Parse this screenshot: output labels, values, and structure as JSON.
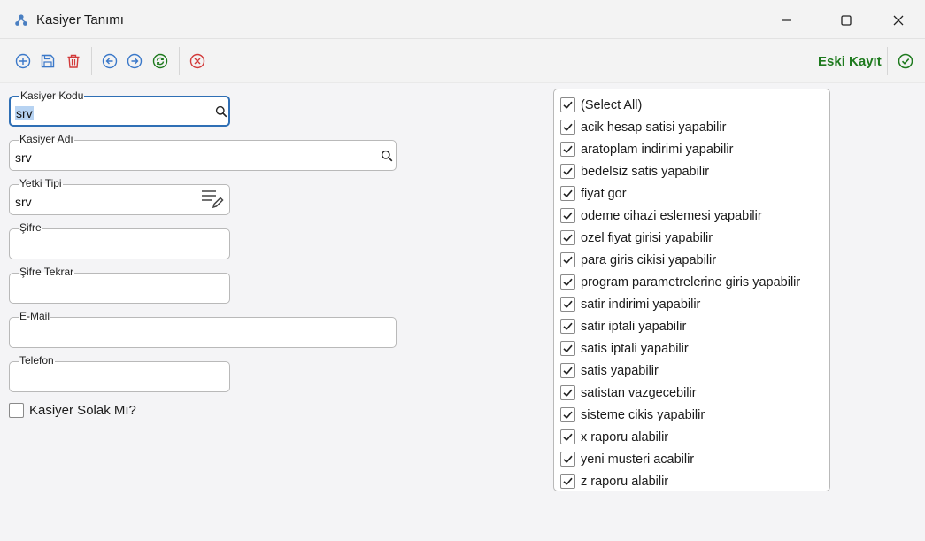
{
  "window": {
    "title": "Kasiyer Tanımı"
  },
  "toolbar": {
    "buttons": [
      {
        "name": "add-icon",
        "color": "#3a78c9"
      },
      {
        "name": "save-icon",
        "color": "#3a78c9"
      },
      {
        "name": "delete-icon",
        "color": "#d23a3a"
      },
      {
        "name": "previous-icon",
        "color": "#3a78c9"
      },
      {
        "name": "next-icon",
        "color": "#3a78c9"
      },
      {
        "name": "refresh-icon",
        "color": "#1e7a1e"
      },
      {
        "name": "cancel-icon",
        "color": "#d23a3a"
      }
    ],
    "eski_kayit": "Eski Kayıt"
  },
  "form": {
    "kasiyer_kodu": {
      "label": "Kasiyer Kodu",
      "value": "srv"
    },
    "kasiyer_adi": {
      "label": "Kasiyer Adı",
      "value": "srv"
    },
    "yetki_tipi": {
      "label": "Yetki Tipi",
      "value": "srv"
    },
    "sifre": {
      "label": "Şifre",
      "value": ""
    },
    "sifre_tekrar": {
      "label": "Şifre Tekrar",
      "value": ""
    },
    "email": {
      "label": "E-Mail",
      "value": ""
    },
    "telefon": {
      "label": "Telefon",
      "value": ""
    },
    "solak": {
      "label": "Kasiyer Solak Mı?",
      "checked": false
    }
  },
  "permissions": [
    {
      "label": "(Select All)",
      "checked": true
    },
    {
      "label": "acik hesap satisi yapabilir",
      "checked": true
    },
    {
      "label": "aratoplam indirimi yapabilir",
      "checked": true
    },
    {
      "label": "bedelsiz satis yapabilir",
      "checked": true
    },
    {
      "label": "fiyat gor",
      "checked": true
    },
    {
      "label": "odeme cihazi eslemesi yapabilir",
      "checked": true
    },
    {
      "label": "ozel fiyat girisi yapabilir",
      "checked": true
    },
    {
      "label": "para giris cikisi yapabilir",
      "checked": true
    },
    {
      "label": "program parametrelerine giris yapabilir",
      "checked": true
    },
    {
      "label": "satir indirimi yapabilir",
      "checked": true
    },
    {
      "label": "satir iptali yapabilir",
      "checked": true
    },
    {
      "label": "satis iptali yapabilir",
      "checked": true
    },
    {
      "label": "satis yapabilir",
      "checked": true
    },
    {
      "label": "satistan vazgecebilir",
      "checked": true
    },
    {
      "label": "sisteme cikis yapabilir",
      "checked": true
    },
    {
      "label": "x raporu alabilir",
      "checked": true
    },
    {
      "label": "yeni musteri acabilir",
      "checked": true
    },
    {
      "label": "z raporu alabilir",
      "checked": true
    }
  ]
}
